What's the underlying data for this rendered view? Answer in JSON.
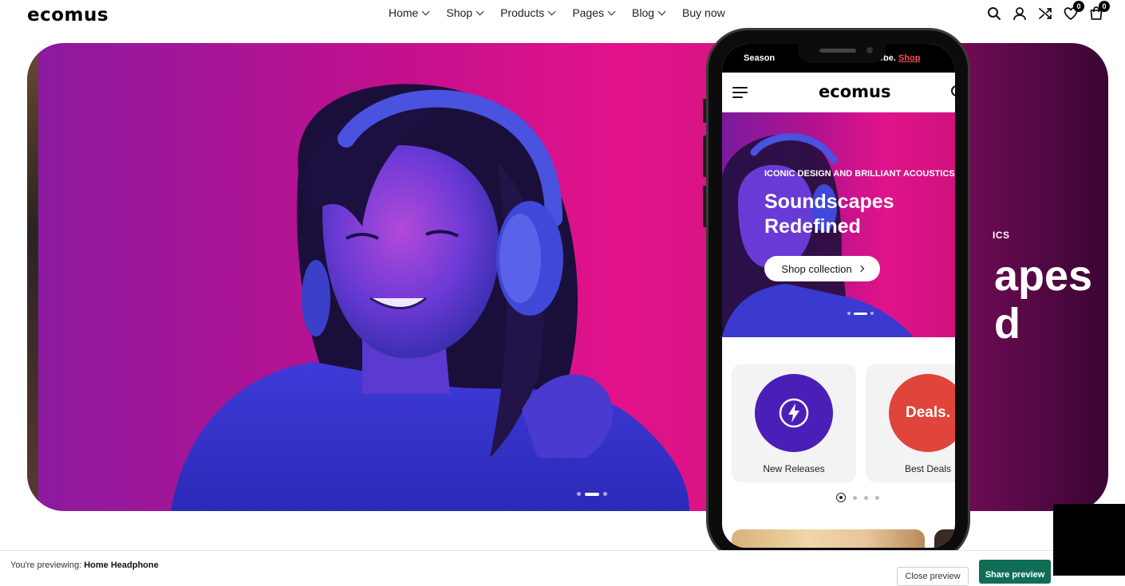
{
  "header": {
    "logo": "ecomus",
    "nav": [
      {
        "label": "Home",
        "dropdown": true
      },
      {
        "label": "Shop",
        "dropdown": true
      },
      {
        "label": "Products",
        "dropdown": true
      },
      {
        "label": "Pages",
        "dropdown": true
      },
      {
        "label": "Blog",
        "dropdown": true
      },
      {
        "label": "Buy now",
        "dropdown": false
      }
    ],
    "icons": [
      "search-icon",
      "user-icon",
      "compare-icon",
      "wishlist-icon",
      "cart-icon"
    ],
    "wishlist_count": "0",
    "cart_count": "0"
  },
  "hero": {
    "eyebrow_partial": "ICS",
    "title_line1_partial": "apes",
    "title_line2_partial": "d",
    "slides": 3,
    "active_slide": 2
  },
  "mobile": {
    "announcement": "Season",
    "announcement_mid": "drobe.",
    "announcement_link": "Shop",
    "logo": "ecomus",
    "hero": {
      "eyebrow": "ICONIC DESIGN AND BRILLIANT ACOUSTICS",
      "title_line1": "Soundscapes",
      "title_line2": "Redefined",
      "button": "Shop collection"
    },
    "categories": [
      {
        "label": "New Releases",
        "circle_color": "#4a1fb8",
        "icon": "lightning-icon"
      },
      {
        "label": "Best Deals",
        "circle_color": "#e0443a",
        "circle_text": "Deals."
      }
    ],
    "category_pages": 4,
    "active_category_page": 1
  },
  "preview_bar": {
    "prefix": "You're previewing: ",
    "theme_name": "Home Headphone",
    "close_label": "Close preview",
    "share_label": "Share preview"
  },
  "colors": {
    "brand_black": "#000000",
    "hero_magenta": "#e2128b",
    "share_green": "#0f6e55",
    "announcement_link": "#ff4d4d"
  }
}
